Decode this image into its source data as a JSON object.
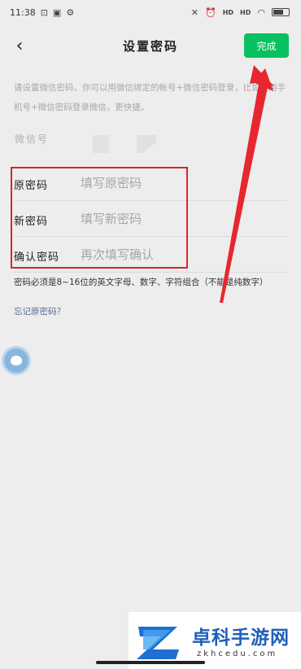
{
  "status_bar": {
    "time": "11:38",
    "left_icons": [
      "notification-icon",
      "image-icon",
      "settings-icon"
    ],
    "right_icons": [
      "mute-icon",
      "alarm-icon",
      "hd-signal-icon",
      "hd-signal-icon",
      "wifi-icon",
      "battery-icon"
    ],
    "left_glyphs": [
      "⊡",
      "▣",
      "⚙"
    ],
    "right_glyphs": [
      "✕",
      "⏰",
      "HD",
      "HD",
      "◠"
    ]
  },
  "nav": {
    "back_icon": "‹",
    "title": "设置密码",
    "done_label": "完成"
  },
  "description": "请设置微信密码，你可以用微信绑定的帐号+微信密码登录，比如使用手机号+微信密码登录微信，更快捷。",
  "wechat_id": {
    "label": "微信号"
  },
  "password_fields": [
    {
      "label": "原密码",
      "placeholder": "填写原密码"
    },
    {
      "label": "新密码",
      "placeholder": "填写新密码"
    },
    {
      "label": "确认密码",
      "placeholder": "再次填写确认"
    }
  ],
  "hint": "密码必须是8~16位的英文字母、数字、字符组合（不能是纯数字）",
  "forgot_link": "忘记原密码？",
  "watermark": {
    "brand": "卓科手游网",
    "url": "zkhcedu.com"
  },
  "colors": {
    "accent_green": "#07c160",
    "annotation_red": "#d9242d",
    "background": "#ededed",
    "link_blue": "#576b95"
  }
}
